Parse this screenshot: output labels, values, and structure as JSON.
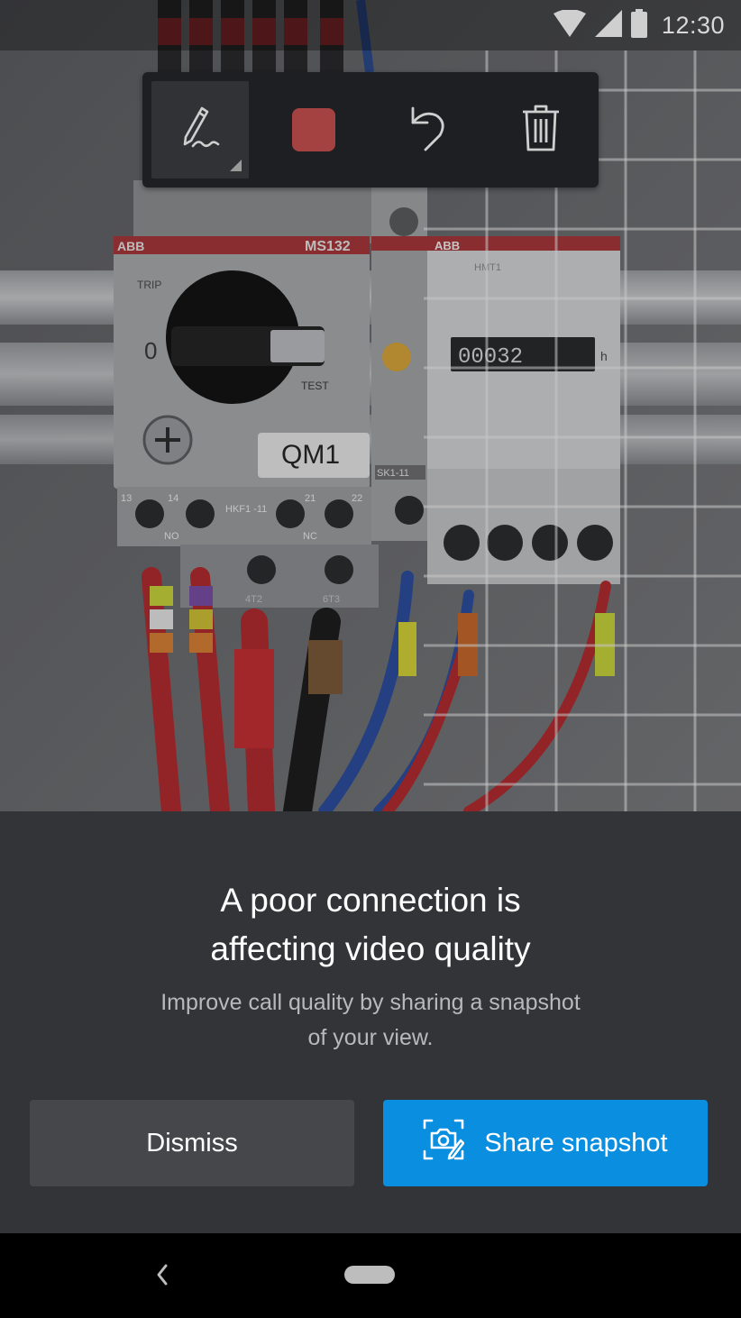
{
  "status_bar": {
    "time": "12:30",
    "icons": [
      "wifi-icon",
      "signal-icon",
      "battery-icon"
    ]
  },
  "camera": {
    "breaker_brand": "ABB",
    "breaker_model": "MS132",
    "breaker_off_label": "0",
    "breaker_trip_label": "TRIP",
    "breaker_test_label": "TEST",
    "device_tag": "QM1",
    "aux_label": "HKF1 -11",
    "aux_contact_label": "SK1-11",
    "meter_brand": "ABB",
    "meter_model": "HMT1",
    "meter_reading": "00032",
    "meter_unit": "h",
    "terminal_labels": [
      "13",
      "14",
      "21",
      "22"
    ],
    "terminal_bottom_labels": [
      "NO",
      "NC"
    ],
    "lower_terminal_labels": [
      "4T2",
      "6T3"
    ]
  },
  "ink_toolbar": {
    "tools": [
      {
        "name": "pen-tool",
        "icon": "pen-icon",
        "selected": true
      },
      {
        "name": "color-tool",
        "icon": "color-swatch",
        "color": "#a44141"
      },
      {
        "name": "undo-tool",
        "icon": "undo-icon"
      },
      {
        "name": "delete-tool",
        "icon": "trash-icon"
      }
    ]
  },
  "sheet": {
    "title_line1": "A poor connection is",
    "title_line2": "affecting video quality",
    "subtitle_line1": "Improve call quality by sharing a snapshot",
    "subtitle_line2": "of your view.",
    "dismiss_label": "Dismiss",
    "share_label": "Share snapshot",
    "share_icon": "snapshot-camera-icon",
    "accent_color": "#0a8ee0"
  },
  "nav_bar": {
    "icons": [
      "back-icon",
      "home-pill"
    ]
  }
}
